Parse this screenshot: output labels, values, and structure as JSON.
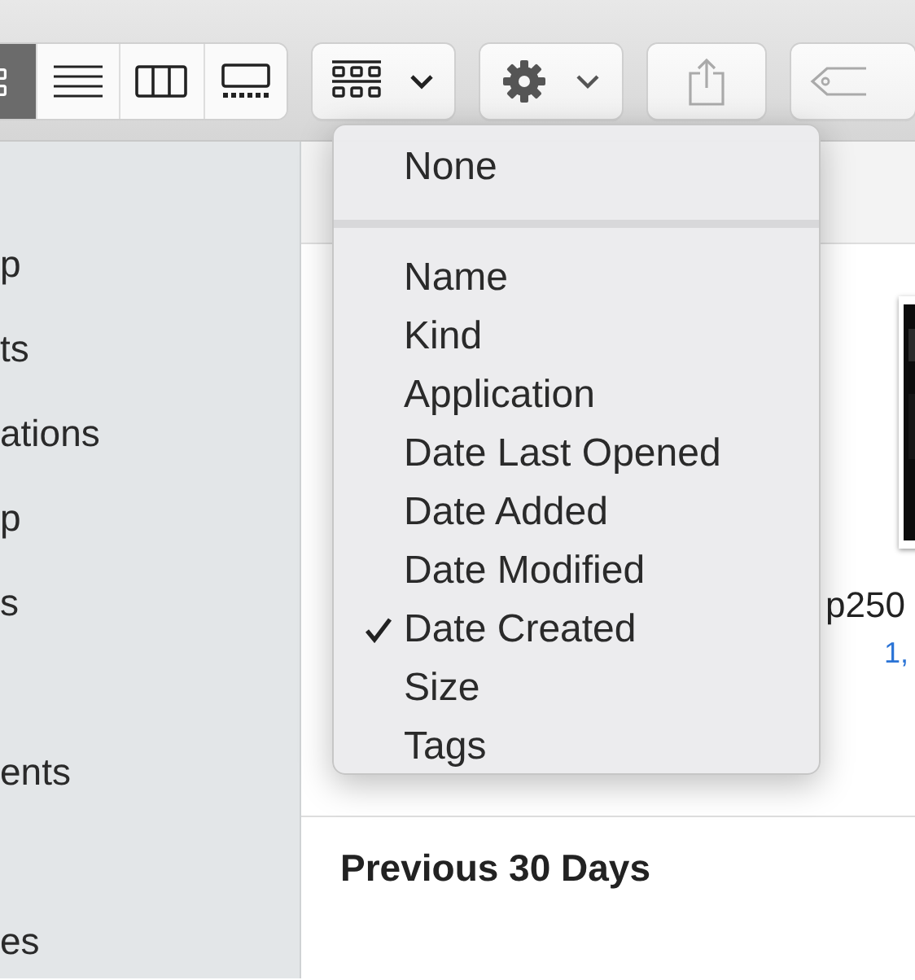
{
  "toolbar": {
    "view_buttons": [
      {
        "kind": "icon",
        "selected": true
      },
      {
        "kind": "list",
        "selected": false
      },
      {
        "kind": "column",
        "selected": false
      },
      {
        "kind": "gallery",
        "selected": false
      }
    ]
  },
  "sidebar": {
    "items": [
      {
        "kind": "item",
        "label": "p"
      },
      {
        "kind": "item",
        "label": "ts"
      },
      {
        "kind": "item",
        "label": "ations"
      },
      {
        "kind": "item",
        "label": "p"
      },
      {
        "kind": "item",
        "label": "s"
      },
      {
        "kind": "spacer"
      },
      {
        "kind": "item",
        "label": "ents"
      },
      {
        "kind": "spacer"
      },
      {
        "kind": "item",
        "label": "es"
      }
    ]
  },
  "group_menu": {
    "items": [
      {
        "kind": "item",
        "label": "None",
        "checked": false
      },
      {
        "kind": "separator"
      },
      {
        "kind": "item",
        "label": "Name",
        "checked": false
      },
      {
        "kind": "item",
        "label": "Kind",
        "checked": false
      },
      {
        "kind": "item",
        "label": "Application",
        "checked": false
      },
      {
        "kind": "item",
        "label": "Date Last Opened",
        "checked": false
      },
      {
        "kind": "item",
        "label": "Date Added",
        "checked": false
      },
      {
        "kind": "item",
        "label": "Date Modified",
        "checked": false
      },
      {
        "kind": "item",
        "label": "Date Created",
        "checked": true
      },
      {
        "kind": "item",
        "label": "Size",
        "checked": false
      },
      {
        "kind": "item",
        "label": "Tags",
        "checked": false
      }
    ]
  },
  "content": {
    "item_name": "p250",
    "item_size": "1,",
    "section_heading": "Previous 30 Days"
  }
}
